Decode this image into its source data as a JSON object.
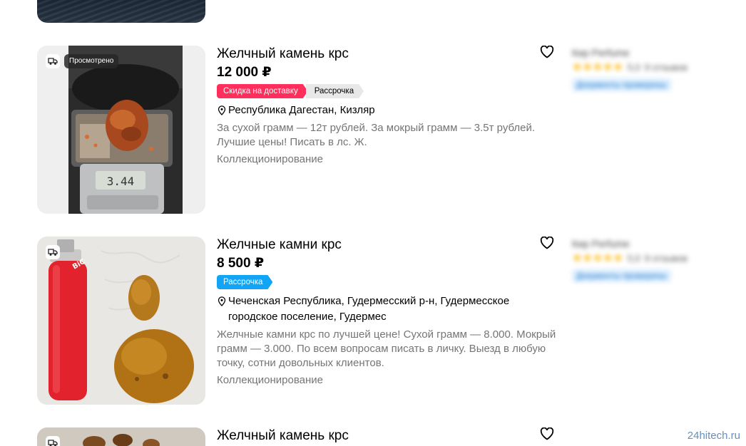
{
  "listings": [
    {
      "title": "Желчный камень крс",
      "price": "12 000 ₽",
      "tags": [
        {
          "label": "Скидка на доставку",
          "color": "#ff2e5a"
        },
        {
          "label": "Рассрочка",
          "color": "#e8e8e8"
        }
      ],
      "viewed_badge": "Просмотрено",
      "location": "Республика Дагестан, Кизляр",
      "description": "За сухой грамм — 12т рублей. За мокрый грамм — 3.5т рублей. Лучшие цены! Писать в лс. Ж.",
      "category": "Коллекционирование",
      "seller": {
        "name": "Кир Perfume",
        "rating": "5,0",
        "reviews": "9 отзывов",
        "docs": "Документы проверены"
      }
    },
    {
      "title": "Желчные камни крс",
      "price": "8 500 ₽",
      "tags": [
        {
          "label": "Рассрочка",
          "color": "#12a4f5"
        }
      ],
      "location": "Чеченская Республика, Гудермесский р-н, Гудермесское городское поселение, Гудермес",
      "description": "Желчные камни крс по лучшей цене! Сухой грамм — 8.000. Мокрый грамм — 3.000. По всем вопросам писать в личку. Выезд в любую точку, сотни довольных клиентов.",
      "category": "Коллекционирование",
      "seller": {
        "name": "Кир Perfume",
        "rating": "5,0",
        "reviews": "9 отзывов",
        "docs": "Документы проверены"
      }
    },
    {
      "title": "Желчный камень крс"
    }
  ],
  "watermark": "24hitech.ru",
  "icons": {
    "heart": "heart-outline-icon",
    "pin": "location-pin-icon",
    "delivery": "delivery-truck-icon",
    "star": "star-icon"
  }
}
